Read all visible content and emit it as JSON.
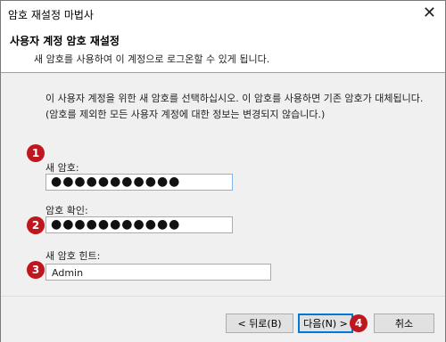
{
  "window": {
    "title": "암호 재설정 마법사",
    "close_glyph": "✕"
  },
  "header": {
    "title": "사용자 계정 암호 재설정",
    "subtitle": "새 암호를 사용하여 이 계정으로 로그온할 수 있게 됩니다."
  },
  "body": {
    "instruction": "이 사용자 계정을 위한 새 암호를 선택하십시오. 이 암호를 사용하면 기존 암호가 대체됩니다. (암호를 제외한 모든 사용자 계정에 대한 정보는 변경되지 않습니다.)",
    "new_password_label": "새 암호:",
    "new_password_value": "●●●●●●●●●●●",
    "confirm_password_label": "암호 확인:",
    "confirm_password_value": "●●●●●●●●●●●",
    "hint_label": "새 암호 힌트:",
    "hint_value": "Admin"
  },
  "badges": [
    "1",
    "2",
    "3",
    "4"
  ],
  "badge_color": "#c0161d",
  "footer": {
    "back_label": "< 뒤로(B)",
    "next_label": "다음(N) >",
    "cancel_label": "취소"
  }
}
